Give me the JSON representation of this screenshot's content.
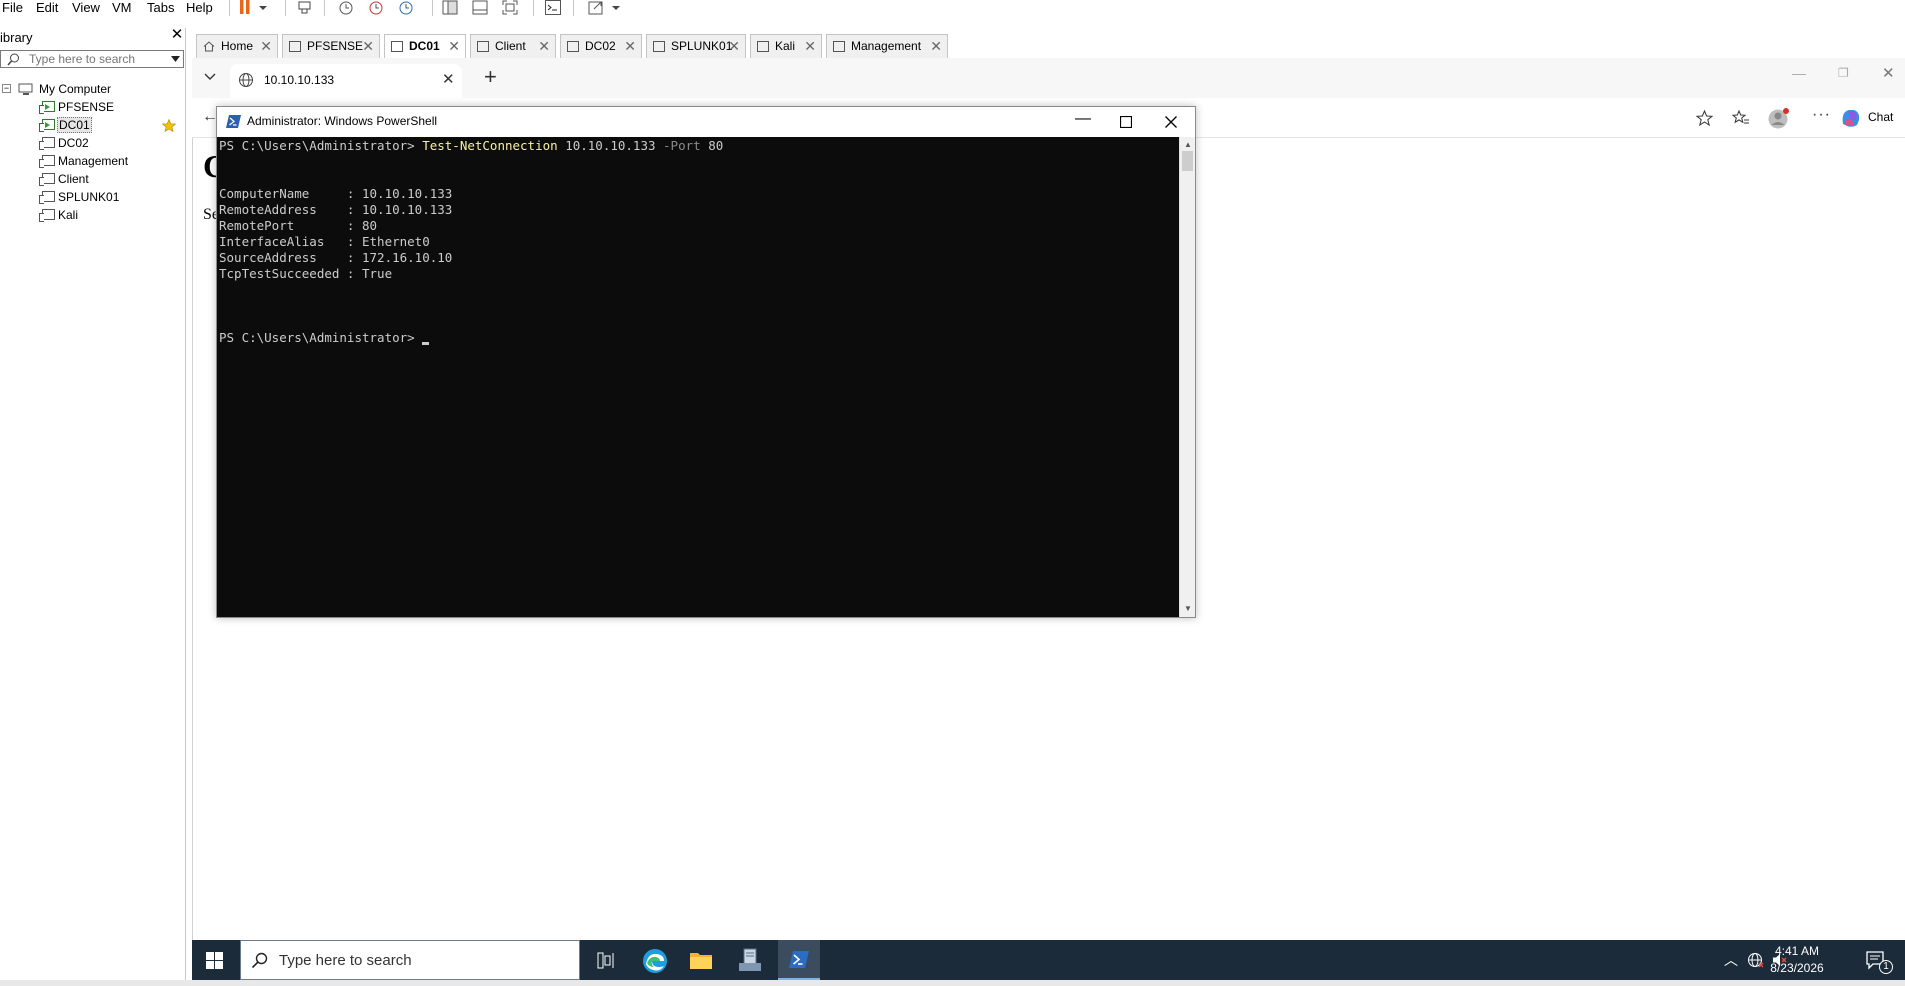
{
  "menu": {
    "file": "File",
    "edit": "Edit",
    "view": "View",
    "vm": "VM",
    "tabs": "Tabs",
    "help": "Help"
  },
  "library": {
    "title": "ibrary",
    "search_placeholder": "Type here to search",
    "root": "My Computer",
    "items": [
      {
        "label": "PFSENSE",
        "running": true
      },
      {
        "label": "DC01",
        "running": true
      },
      {
        "label": "DC02",
        "running": false
      },
      {
        "label": "Management",
        "running": false
      },
      {
        "label": "Client",
        "running": false
      },
      {
        "label": "SPLUNK01",
        "running": false
      },
      {
        "label": "Kali",
        "running": false
      }
    ]
  },
  "vm_tabs": [
    "Home",
    "PFSENSE",
    "DC01",
    "Client",
    "DC02",
    "SPLUNK01",
    "Kali",
    "Management"
  ],
  "browser": {
    "tab_title": "10.10.10.133",
    "chat_label": "Chat",
    "page_partial_heading": "C",
    "page_partial_text": "Se"
  },
  "powershell": {
    "title": "Administrator: Windows PowerShell",
    "prompt": "PS C:\\Users\\Administrator> ",
    "command": "Test-NetConnection",
    "arg": " 10.10.10.133 ",
    "param": "-Port",
    "param_value": " 80",
    "results": [
      "ComputerName     : 10.10.10.133",
      "RemoteAddress    : 10.10.10.133",
      "RemotePort       : 80",
      "InterfaceAlias   : Ethernet0",
      "SourceAddress    : 172.16.10.10",
      "TcpTestSucceeded : True"
    ],
    "final_prompt": "PS C:\\Users\\Administrator> "
  },
  "taskbar": {
    "search_placeholder": "Type here to search",
    "time": "4:41 AM",
    "date": "8/23/2026",
    "notification_count": "1"
  },
  "colors": {
    "console_bg": "#0c0c0c",
    "console_fg": "#cccccc",
    "command_yellow": "#f9f1a5",
    "taskbar_bg": "#1b2b3a",
    "vmware_pause_orange": "#e8661a"
  }
}
